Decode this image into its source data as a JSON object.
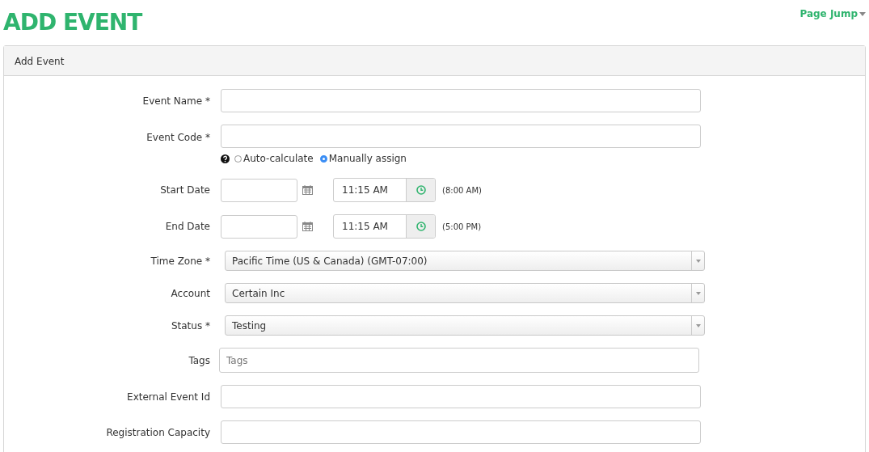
{
  "page_title": "ADD EVENT",
  "page_jump": {
    "label": "Page Jump"
  },
  "panel": {
    "title": "Add Event"
  },
  "fields": [
    {
      "kind": "text",
      "label": "Event Name *"
    },
    {
      "kind": "text",
      "label": "Event Code *",
      "options": [
        {
          "label": "Auto-calculate",
          "selected": false
        },
        {
          "label": "Manually assign",
          "selected": true
        }
      ]
    },
    {
      "kind": "datetime",
      "label": "Start Date",
      "time": "11:15 AM",
      "hint": "(8:00 AM)"
    },
    {
      "kind": "datetime",
      "label": "End Date",
      "time": "11:15 AM",
      "hint": "(5:00 PM)"
    },
    {
      "kind": "select",
      "label": "Time Zone *",
      "value": "Pacific Time (US & Canada) (GMT-07:00)"
    },
    {
      "kind": "select",
      "label": "Account",
      "value": "Certain Inc"
    },
    {
      "kind": "select",
      "label": "Status *",
      "value": "Testing"
    },
    {
      "kind": "tags",
      "label": "Tags",
      "placeholder": "Tags"
    },
    {
      "kind": "text",
      "label": "External Event Id"
    },
    {
      "kind": "text",
      "label": "Registration Capacity"
    }
  ]
}
